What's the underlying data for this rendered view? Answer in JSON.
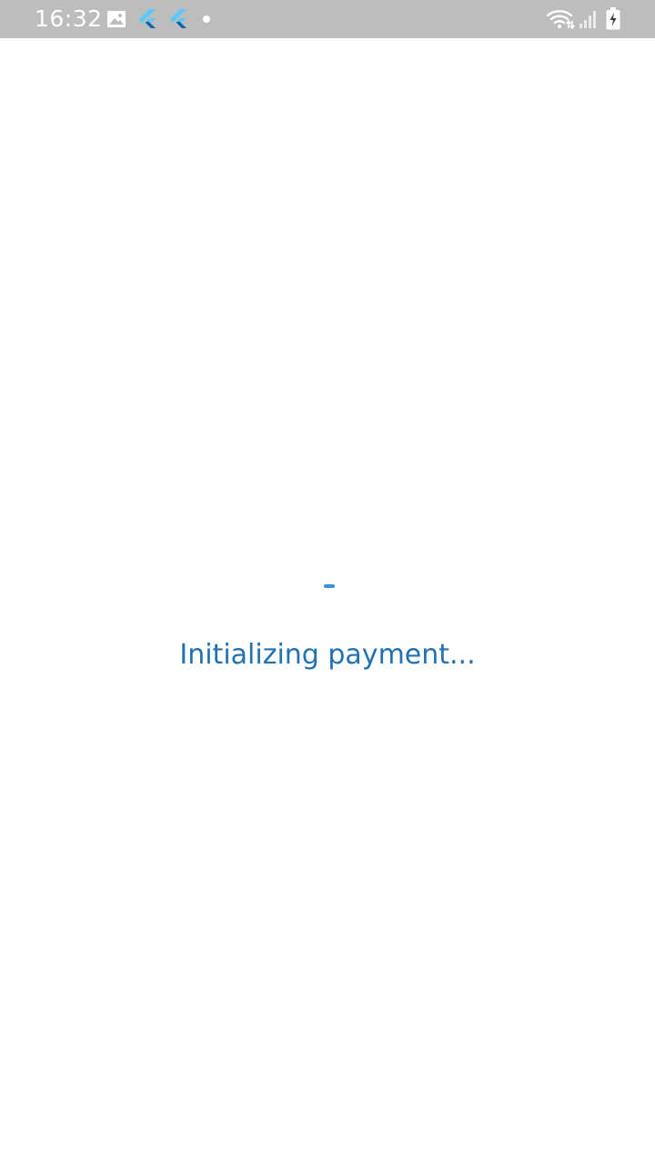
{
  "status_bar": {
    "time": "16:32",
    "icons": [
      "image-icon",
      "flutter-icon",
      "flutter-icon",
      "dot-icon",
      "wifi-icon",
      "signal-icon",
      "battery-charging-icon"
    ]
  },
  "main": {
    "loading_text": "Initializing payment..."
  },
  "colors": {
    "status_bar_bg": "#bdbdbd",
    "accent": "#2272b3",
    "spinner": "#3d8fd6",
    "flutter_light": "#5ec8f8",
    "flutter_dark": "#0a5fa8"
  }
}
